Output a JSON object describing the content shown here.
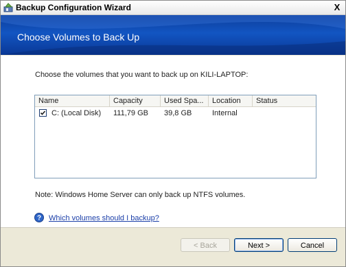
{
  "window": {
    "title": "Backup Configuration Wizard",
    "close_glyph": "X"
  },
  "banner": {
    "title": "Choose Volumes to Back Up"
  },
  "content": {
    "prompt": "Choose the volumes that you want to back up on KILI-LAPTOP:",
    "columns": [
      "Name",
      "Capacity",
      "Used Spa...",
      "Location",
      "Status"
    ],
    "rows": [
      {
        "checked": true,
        "name": "C: (Local Disk)",
        "capacity": "111,79 GB",
        "used": "39,8 GB",
        "location": "Internal",
        "status": ""
      }
    ],
    "note": "Note: Windows Home Server can only back up NTFS volumes.",
    "help_link": "Which volumes should I backup?"
  },
  "buttons": {
    "back": "< Back",
    "next": "Next >",
    "cancel": "Cancel"
  },
  "icons": {
    "app": "backup-wizard-icon",
    "help": "help-question-icon",
    "check": "checkmark-icon"
  },
  "colors": {
    "banner": "#1255c2",
    "link": "#1a3ea8"
  }
}
